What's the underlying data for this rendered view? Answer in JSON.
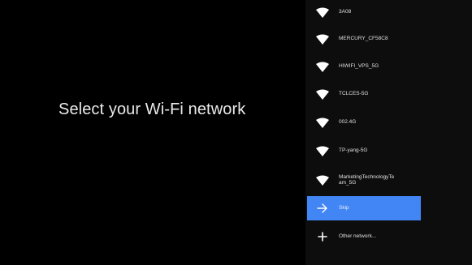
{
  "title": "Select your Wi-Fi network",
  "networks": [
    {
      "label": "3A08",
      "icon": "wifi-icon"
    },
    {
      "label": "MERCURY_CF58C8",
      "icon": "wifi-icon"
    },
    {
      "label": "HIWIFI_VPS_5G",
      "icon": "wifi-icon"
    },
    {
      "label": "TCLCES-5G",
      "icon": "wifi-icon"
    },
    {
      "label": "002.4G",
      "icon": "wifi-icon"
    },
    {
      "label": "TP-yang-5G",
      "icon": "wifi-icon"
    },
    {
      "label": "MarketingTechnologyTe\nam_5G",
      "icon": "wifi-icon"
    }
  ],
  "skip": {
    "label": "Skip",
    "icon": "arrow-right-icon"
  },
  "other": {
    "label": "Other network...",
    "icon": "plus-icon"
  },
  "colors": {
    "background": "#000000",
    "accent": "#4285f4"
  }
}
